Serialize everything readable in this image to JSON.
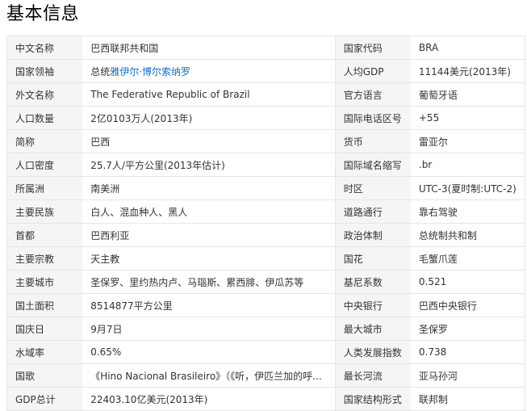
{
  "page_title": "基本信息",
  "leader": {
    "prefix": "总统",
    "name_link": "雅伊尔·博尔索纳罗"
  },
  "rows": [
    {
      "k1": "中文名称",
      "v1": "巴西联邦共和国",
      "k2": "国家代码",
      "v2": "BRA"
    },
    {
      "k1": "国家领袖",
      "v1": "",
      "k2": "人均GDP",
      "v2": "11144美元(2013年)"
    },
    {
      "k1": "外文名称",
      "v1": "The Federative Republic of Brazil",
      "k2": "官方语言",
      "v2": "葡萄牙语"
    },
    {
      "k1": "人口数量",
      "v1": "2亿0103万人(2013年)",
      "k2": "国际电话区号",
      "v2": "+55"
    },
    {
      "k1": "简称",
      "v1": "巴西",
      "k2": "货币",
      "v2": "雷亚尔"
    },
    {
      "k1": "人口密度",
      "v1": "25.7人/平方公里(2013年估计)",
      "k2": "国际域名缩写",
      "v2": ".br"
    },
    {
      "k1": "所属洲",
      "v1": "南美洲",
      "k2": "时区",
      "v2": "UTC-3(夏时制:UTC-2)"
    },
    {
      "k1": "主要民族",
      "v1": "白人、混血种人、黑人",
      "k2": "道路通行",
      "v2": "靠右驾驶"
    },
    {
      "k1": "首都",
      "v1": "巴西利亚",
      "k2": "政治体制",
      "v2": "总统制共和制"
    },
    {
      "k1": "主要宗教",
      "v1": "天主教",
      "k2": "国花",
      "v2": "毛蟹爪莲"
    },
    {
      "k1": "主要城市",
      "v1": "圣保罗、里约热内卢、马瑙斯、累西腓、伊瓜苏等",
      "k2": "基尼系数",
      "v2": "0.521"
    },
    {
      "k1": "国土面积",
      "v1": "8514877平方公里",
      "k2": "中央银行",
      "v2": "巴西中央银行"
    },
    {
      "k1": "国庆日",
      "v1": "9月7日",
      "k2": "最大城市",
      "v2": "圣保罗"
    },
    {
      "k1": "水域率",
      "v1": "0.65%",
      "k2": "人类发展指数",
      "v2": "0.738"
    },
    {
      "k1": "国歌",
      "v1": "《Hino Nacional Brasileiro》（《听，伊匹兰加的呼...",
      "k2": "最长河流",
      "v2": "亚马孙河"
    },
    {
      "k1": "GDP总计",
      "v1": "22403.10亿美元(2013年)",
      "k2": "国家结构形式",
      "v2": "联邦制"
    }
  ]
}
